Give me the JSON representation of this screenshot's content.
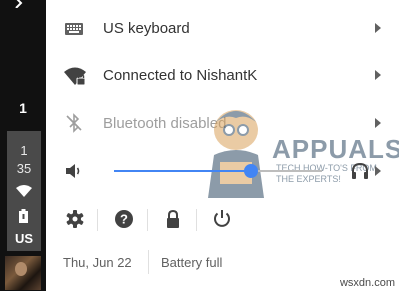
{
  "shelf": {
    "notification_count": "1",
    "tray": {
      "hour": "1",
      "minute": "35",
      "language": "US"
    }
  },
  "menu": {
    "keyboard": {
      "label": "US keyboard",
      "icon": "keyboard-icon"
    },
    "network": {
      "label": "Connected to NishantK",
      "icon": "wifi-icon"
    },
    "bluetooth": {
      "label": "Bluetooth disabled",
      "icon": "bluetooth-disabled-icon"
    }
  },
  "volume": {
    "level": 0.66,
    "output_icon": "headphones-icon"
  },
  "tools": [
    "settings-icon",
    "help-icon",
    "lock-icon",
    "power-icon"
  ],
  "footer": {
    "date": "Thu, Jun 22",
    "battery": "Battery full"
  },
  "watermark": {
    "brand": "APPUALS",
    "tagline_1": "TECH HOW-TO'S FROM",
    "tagline_2": "THE EXPERTS!"
  },
  "site": "wsxdn.com",
  "colors": {
    "accent": "#4285f4",
    "shelf": "#111111",
    "tray": "#4a4a4a"
  }
}
